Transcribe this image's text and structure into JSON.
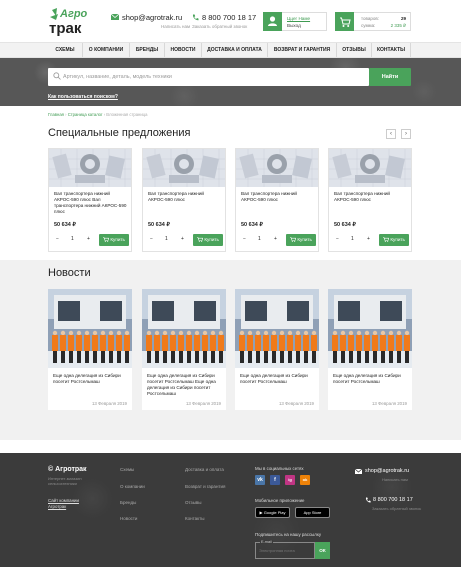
{
  "header": {
    "logo_top": "Агро",
    "logo_bottom": "трак",
    "email": "shop@agrotrak.ru",
    "email_sub": "Написать нам",
    "phone": "8 800 700 18 17",
    "phone_sub": "Заказать обратный звонок",
    "user_label": "Ццег Наме",
    "user_action": "Выход",
    "cart_items_label": "товаров:",
    "cart_items_value": "29",
    "cart_sum_label": "сумма:",
    "cart_sum_value": "2 335 ₽"
  },
  "nav": [
    "СХЕМЫ",
    "О КОМПАНИИ",
    "БРЕНДЫ",
    "НОВОСТИ",
    "ДОСТАВКА И ОПЛАТА",
    "ВОЗВРАТ И ГАРАНТИЯ",
    "ОТЗЫВЫ",
    "КОНТАКТЫ"
  ],
  "search": {
    "placeholder": "Артикул, название, деталь, модель техники",
    "button": "Найти",
    "help": "Как пользоваться поиском?"
  },
  "breadcrumb": [
    "Главная",
    "Страница каталог",
    "Вложенная страница"
  ],
  "specials": {
    "title": "Специальные предложения",
    "products": [
      {
        "name": "Вал транспортера нижний АКРОС-590 плюс Вал транспортера нижний АКРОС-590 плюс",
        "price": "50 634 ₽",
        "qty": "1",
        "buy": "Купить"
      },
      {
        "name": "Вал транспортера нижний АКРОС-590 плюс",
        "price": "50 634 ₽",
        "qty": "1",
        "buy": "Купить"
      },
      {
        "name": "Вал транспортера нижний АКРОС-590 плюс",
        "price": "50 634 ₽",
        "qty": "1",
        "buy": "Купить"
      },
      {
        "name": "Вал транспортера нижний АКРОС-590 плюс",
        "price": "50 634 ₽",
        "qty": "1",
        "buy": "Купить"
      }
    ]
  },
  "news": {
    "title": "Новости",
    "items": [
      {
        "text": "Еще одна делегация из Сибири посетит Ростсельмаш",
        "date": "13 Февраля 2019"
      },
      {
        "text": "Еще одна делегация из Сибири посетит Ростсельмаш Еще одна делегация из Сибири посетит Ростсельмаш",
        "date": "13 Февраля 2019"
      },
      {
        "text": "Еще одна делегация из Сибири посетит Ростсельмаш",
        "date": "13 Февраля 2019"
      },
      {
        "text": "Еще одна делегация из Сибири посетит Ростсельмаш",
        "date": "13 Февраля 2019"
      }
    ]
  },
  "footer": {
    "brand": "© Агротрак",
    "desc": "Интернет-магазин сельхозтехники",
    "dev_link": "Сайт компании Агротрак",
    "col1": [
      "Схемы",
      "О компании",
      "Бренды",
      "Новости"
    ],
    "col2": [
      "Доставка и оплата",
      "Возврат и гарантия",
      "Отзывы",
      "Контакты"
    ],
    "social_title": "Мы в социальных сетях",
    "social": [
      "vk",
      "f",
      "ig",
      "ok"
    ],
    "app_title": "Мобильное приложение",
    "google_play": "Google Play",
    "app_store": "App Store",
    "subscribe_title": "Подпишитесь на нашу рассылку",
    "subscribe_label": "E-mail",
    "subscribe_placeholder": "Электронная почта",
    "subscribe_button": "ОК",
    "email": "shop@agrotrak.ru",
    "email_sub": "Написать нам",
    "phone": "8 800 700 18 17",
    "phone_sub": "Заказать обратный звонок"
  },
  "colors": {
    "accent": "#4aa35b",
    "dark": "#3b3b3b"
  }
}
